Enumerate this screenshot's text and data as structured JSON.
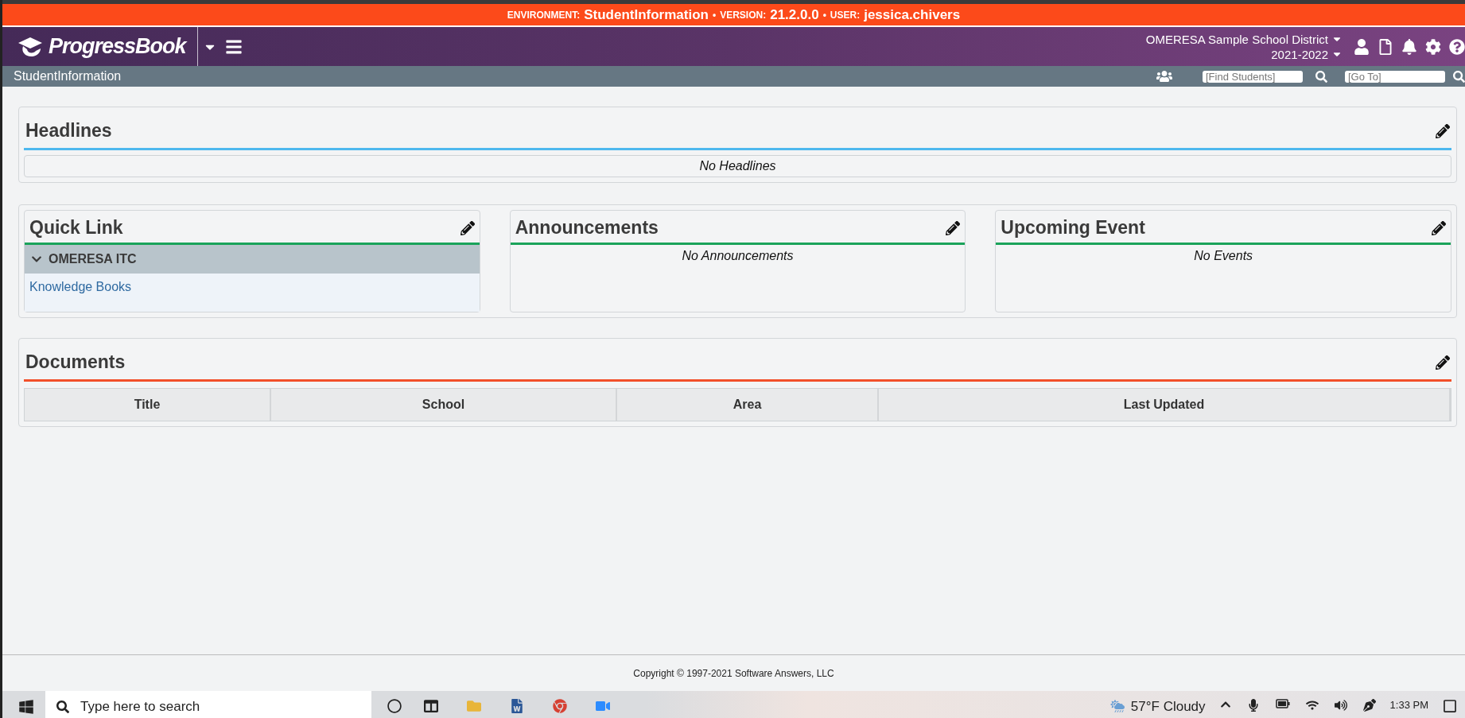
{
  "environment_bar": [
    {
      "kind": "label",
      "text": "ENVIRONMENT:"
    },
    {
      "kind": "value",
      "text": "StudentInformation"
    },
    {
      "kind": "separator",
      "text": "•"
    },
    {
      "kind": "label",
      "text": "VERSION:"
    },
    {
      "kind": "value",
      "text": "21.2.0.0"
    },
    {
      "kind": "separator",
      "text": "•"
    },
    {
      "kind": "label",
      "text": "USER:"
    },
    {
      "kind": "value",
      "text": "jessica.chivers"
    }
  ],
  "header": {
    "logo": "ProgressBook",
    "district": "OMERESA Sample School District",
    "school_year": "2021-2022"
  },
  "subbar": {
    "title": "StudentInformation",
    "find_students": {
      "placeholder": "[Find Students]"
    },
    "go_to": {
      "placeholder": "[Go To]"
    }
  },
  "headlines": {
    "title": "Headlines",
    "empty_text": "No Headlines"
  },
  "widgets": [
    {
      "kind": "links",
      "title": "Quick Link",
      "group": {
        "name": "OMERESA ITC",
        "expanded": true
      },
      "links": [
        "Knowledge Books"
      ]
    },
    {
      "kind": "empty",
      "title": "Announcements",
      "empty_text": "No Announcements"
    },
    {
      "kind": "empty",
      "title": "Upcoming Event",
      "empty_text": "No Events"
    }
  ],
  "documents": {
    "title": "Documents",
    "columns": [
      "Title",
      "School",
      "Area",
      "Last Updated"
    ]
  },
  "footer": {
    "copyright": "Copyright © 1997-2021 Software Answers, LLC"
  },
  "taskbar": {
    "search": {
      "placeholder": "Type here to search"
    },
    "weather": "57°F  Cloudy",
    "time": "1:33 PM"
  }
}
